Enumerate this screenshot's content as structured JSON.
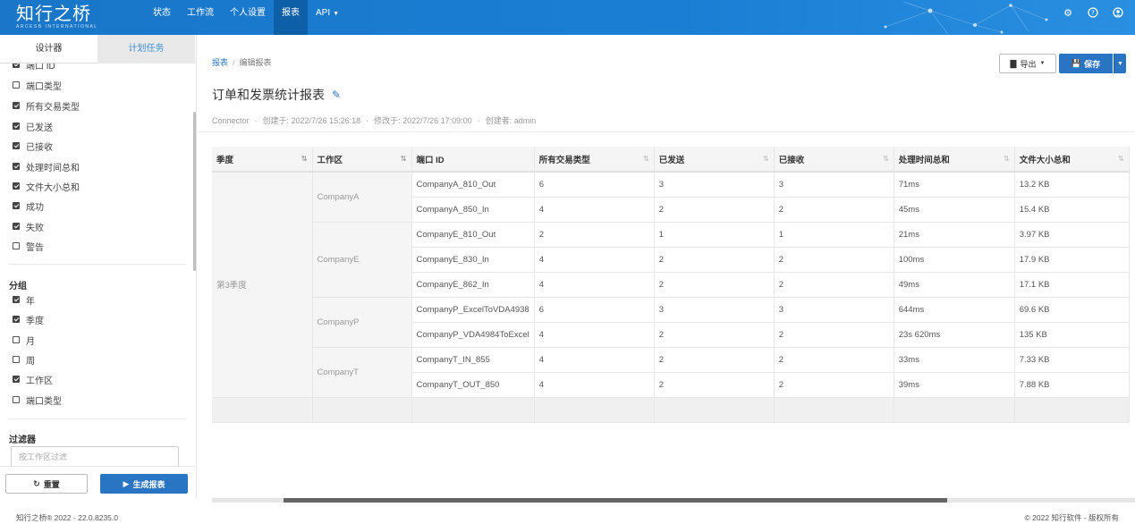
{
  "app": {
    "logo_cn": "知行之桥",
    "logo_en": "ARCESB INTERNATIONAL"
  },
  "nav": {
    "items": [
      "状态",
      "工作流",
      "个人设置",
      "报表",
      "API"
    ],
    "active": "报表"
  },
  "sidebar": {
    "tabs": [
      "设计器",
      "计划任务"
    ],
    "columns": [
      {
        "label": "端口 ID",
        "checked": true
      },
      {
        "label": "端口类型",
        "checked": false
      },
      {
        "label": "所有交易类型",
        "checked": true
      },
      {
        "label": "已发送",
        "checked": true
      },
      {
        "label": "已接收",
        "checked": true
      },
      {
        "label": "处理时间总和",
        "checked": true
      },
      {
        "label": "文件大小总和",
        "checked": true
      },
      {
        "label": "成功",
        "checked": true
      },
      {
        "label": "失败",
        "checked": true
      },
      {
        "label": "警告",
        "checked": false
      }
    ],
    "group_heading": "分组",
    "groups": [
      {
        "label": "年",
        "checked": true
      },
      {
        "label": "季度",
        "checked": true
      },
      {
        "label": "月",
        "checked": false
      },
      {
        "label": "周",
        "checked": false
      },
      {
        "label": "工作区",
        "checked": true
      },
      {
        "label": "端口类型",
        "checked": false
      }
    ],
    "filter_heading": "过滤器",
    "filter_placeholder": "按工作区过滤",
    "reset_label": "重置",
    "generate_label": "生成报表"
  },
  "main": {
    "breadcrumb": {
      "root": "报表",
      "current": "编辑报表"
    },
    "export_label": "导出",
    "save_label": "保存",
    "title": "订单和发票统计报表",
    "meta": {
      "type": "Connector",
      "created": "创建于: 2022/7/26 15:26:18",
      "modified": "修改于: 2022/7/26 17:09:00",
      "creator": "创建者: admin"
    }
  },
  "table": {
    "headers": [
      "季度",
      "工作区",
      "端口 ID",
      "所有交易类型",
      "已发送",
      "已接收",
      "处理时间总和",
      "文件大小总和"
    ],
    "quarter": "第3季度",
    "groups": [
      {
        "workspace": "CompanyA",
        "rows": [
          [
            "CompanyA_810_Out",
            "6",
            "3",
            "3",
            "71ms",
            "13.2 KB"
          ],
          [
            "CompanyA_850_In",
            "4",
            "2",
            "2",
            "45ms",
            "15.4 KB"
          ]
        ]
      },
      {
        "workspace": "CompanyE",
        "rows": [
          [
            "CompanyE_810_Out",
            "2",
            "1",
            "1",
            "21ms",
            "3.97 KB"
          ],
          [
            "CompanyE_830_In",
            "4",
            "2",
            "2",
            "100ms",
            "17.9 KB"
          ],
          [
            "CompanyE_862_In",
            "4",
            "2",
            "2",
            "49ms",
            "17.1 KB"
          ]
        ]
      },
      {
        "workspace": "CompanyP",
        "rows": [
          [
            "CompanyP_ExcelToVDA4938",
            "6",
            "3",
            "3",
            "644ms",
            "69.6 KB"
          ],
          [
            "CompanyP_VDA4984ToExcel",
            "4",
            "2",
            "2",
            "23s 620ms",
            "135 KB"
          ]
        ]
      },
      {
        "workspace": "CompanyT",
        "rows": [
          [
            "CompanyT_IN_855",
            "4",
            "2",
            "2",
            "33ms",
            "7.33 KB"
          ],
          [
            "CompanyT_OUT_850",
            "4",
            "2",
            "2",
            "39ms",
            "7.88 KB"
          ]
        ]
      }
    ]
  },
  "footer": {
    "left": "知行之桥® 2022 - 22.0.8235.0",
    "right": "© 2022 知行软件 - 版权所有"
  },
  "colors": {
    "topbar": "#1a7fd4",
    "nav_active": "#0d5fa8",
    "primary_button": "#2a74c4"
  }
}
